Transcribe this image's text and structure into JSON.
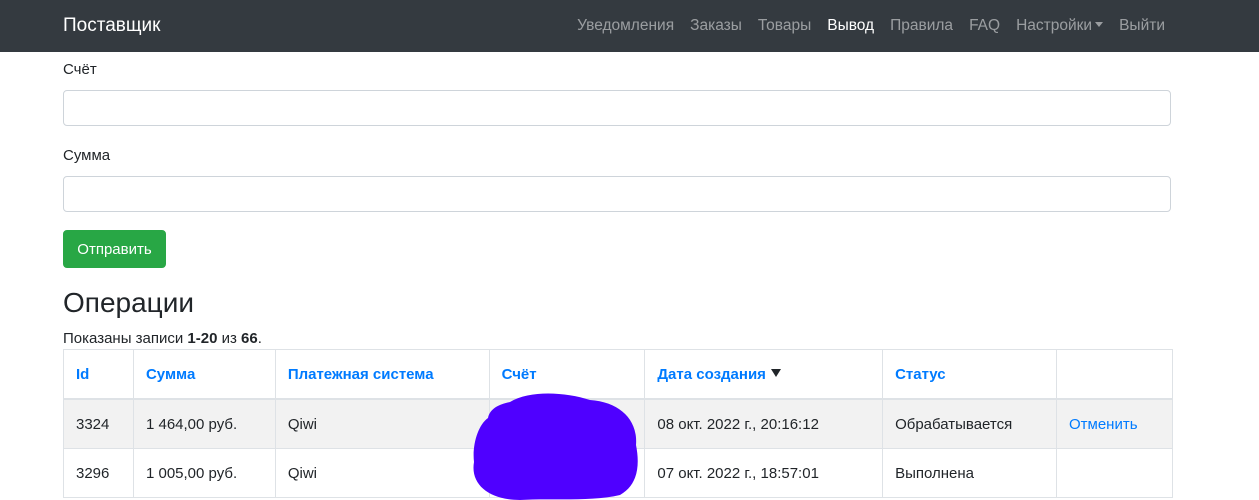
{
  "navbar": {
    "brand": "Поставщик",
    "items": [
      {
        "label": "Уведомления",
        "active": false
      },
      {
        "label": "Заказы",
        "active": false
      },
      {
        "label": "Товары",
        "active": false
      },
      {
        "label": "Вывод",
        "active": true
      },
      {
        "label": "Правила",
        "active": false
      },
      {
        "label": "FAQ",
        "active": false
      },
      {
        "label": "Настройки",
        "active": false,
        "dropdown": true
      },
      {
        "label": "Выйти",
        "active": false
      }
    ]
  },
  "form": {
    "account_label": "Счёт",
    "account_value": "",
    "amount_label": "Сумма",
    "amount_value": "",
    "submit_label": "Отправить"
  },
  "operations": {
    "title": "Операции",
    "summary_prefix": "Показаны записи ",
    "summary_range": "1-20",
    "summary_of": " из ",
    "summary_total": "66",
    "summary_suffix": ".",
    "columns": [
      "Id",
      "Сумма",
      "Платежная система",
      "Счёт",
      "Дата создания",
      "Статус",
      ""
    ],
    "sorted_column": "Дата создания",
    "rows": [
      {
        "id": "3324",
        "amount": "1 464,00 руб.",
        "system": "Qiwi",
        "account": "",
        "created": "08 окт. 2022 г., 20:16:12",
        "status": "Обрабатывается",
        "action": "Отменить"
      },
      {
        "id": "3296",
        "amount": "1 005,00 руб.",
        "system": "Qiwi",
        "account": "",
        "created": "07 окт. 2022 г., 18:57:01",
        "status": "Выполнена",
        "action": ""
      }
    ]
  },
  "colors": {
    "navbar_bg": "#343a40",
    "link": "#007bff",
    "success": "#28a745",
    "redaction": "#4f00ff"
  }
}
